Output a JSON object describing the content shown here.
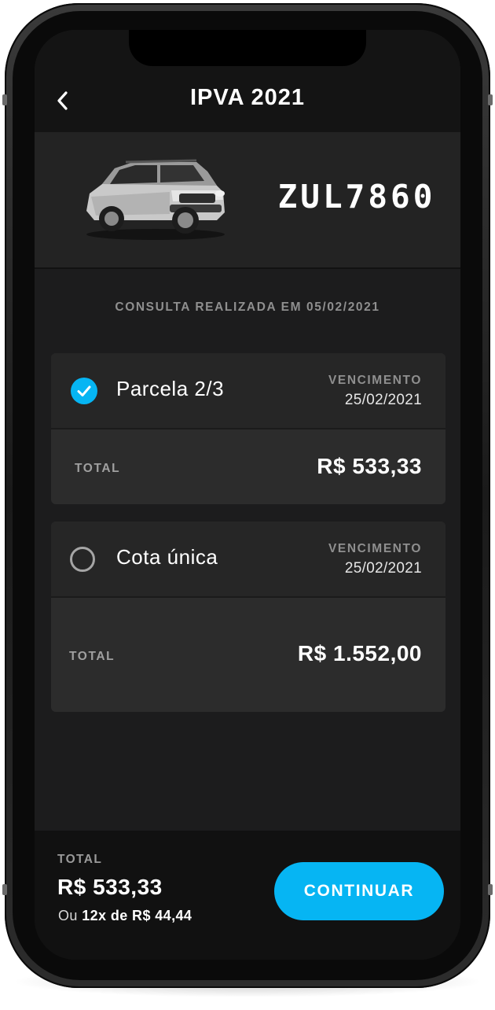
{
  "header": {
    "title": "IPVA 2021",
    "back_icon": "chevron-left-icon"
  },
  "vehicle": {
    "plate": "ZUL7860",
    "image": "car-suv-silver"
  },
  "consulta_text": "CONSULTA REALIZADA EM 05/02/2021",
  "options": [
    {
      "label": "Parcela 2/3",
      "selected": true,
      "due_label": "VENCIMENTO",
      "due_date": "25/02/2021",
      "total_label": "TOTAL",
      "total_value": "R$ 533,33"
    },
    {
      "label": "Cota única",
      "selected": false,
      "due_label": "VENCIMENTO",
      "due_date": "25/02/2021",
      "total_label": "TOTAL",
      "total_value": "R$ 1.552,00"
    }
  ],
  "footer": {
    "total_label": "TOTAL",
    "total_value": "R$ 533,33",
    "installments_prefix": "Ou",
    "installments_text": "12x de R$ 44,44",
    "continue_label": "CONTINUAR"
  },
  "colors": {
    "accent": "#06b5f3",
    "background": "#1c1c1d",
    "card": "#2c2c2c"
  }
}
